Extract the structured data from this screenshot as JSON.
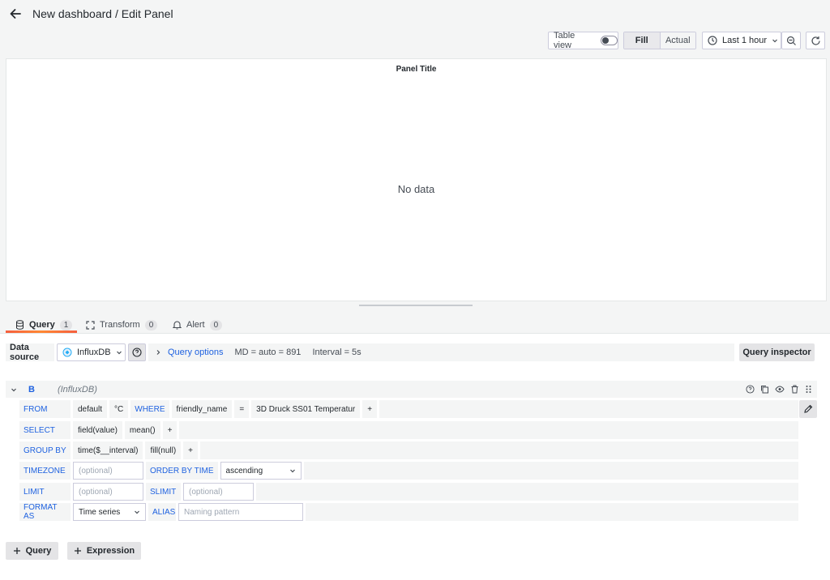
{
  "header": {
    "title": "New dashboard / Edit Panel"
  },
  "toolbar": {
    "table_view_label": "Table view",
    "fill_label": "Fill",
    "actual_label": "Actual",
    "time_range": "Last 1 hour"
  },
  "panel": {
    "title": "Panel Title",
    "empty_text": "No data"
  },
  "tabs": [
    {
      "label": "Query",
      "count": "1"
    },
    {
      "label": "Transform",
      "count": "0"
    },
    {
      "label": "Alert",
      "count": "0"
    }
  ],
  "datasource": {
    "label": "Data source",
    "selected": "InfluxDB",
    "query_options_label": "Query options",
    "md": "MD = auto = 891",
    "interval": "Interval = 5s",
    "inspector_label": "Query inspector"
  },
  "query": {
    "ref_id": "B",
    "datasource_name": "(InfluxDB)",
    "from": {
      "keyword": "FROM",
      "policy": "default",
      "measurement": "°C",
      "where_keyword": "WHERE",
      "tag": "friendly_name",
      "op": "=",
      "value": "3D Druck SS01 Temperatur",
      "plus": "+"
    },
    "select": {
      "keyword": "SELECT",
      "field": "field(value)",
      "agg": "mean()",
      "plus": "+"
    },
    "group_by": {
      "keyword": "GROUP BY",
      "time": "time($__interval)",
      "fill": "fill(null)",
      "plus": "+"
    },
    "timezone": {
      "keyword": "TIMEZONE",
      "placeholder": "(optional)",
      "order_keyword": "ORDER BY TIME",
      "order_value": "ascending"
    },
    "limit": {
      "keyword": "LIMIT",
      "placeholder": "(optional)",
      "slimit_keyword": "SLIMIT",
      "slimit_placeholder": "(optional)"
    },
    "format": {
      "keyword": "FORMAT AS",
      "value": "Time series",
      "alias_keyword": "ALIAS",
      "alias_placeholder": "Naming pattern"
    }
  },
  "footer": {
    "add_query_label": "Query",
    "add_expression_label": "Expression"
  },
  "colors": {
    "accent": "#1f62e0",
    "tab_underline": "#f55f3e"
  }
}
